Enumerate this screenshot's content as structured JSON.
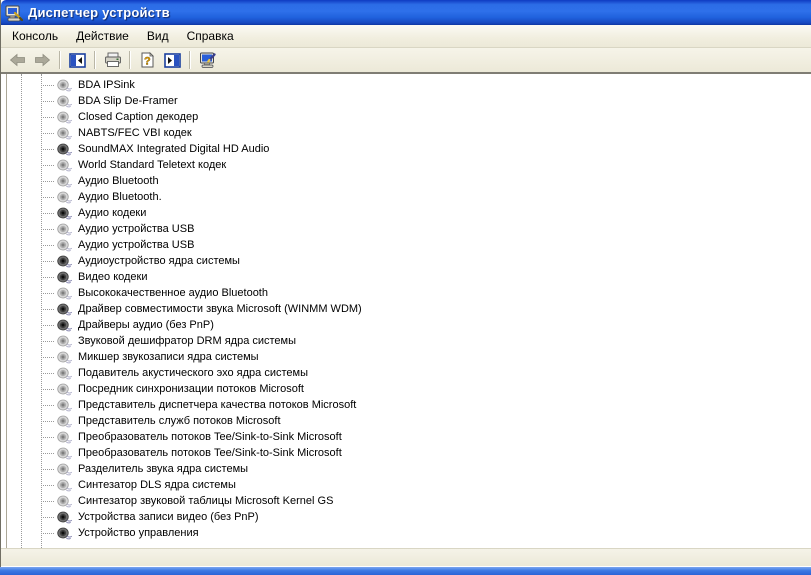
{
  "window": {
    "title": "Диспетчер устройств",
    "title_icon": "device-manager-computer-icon",
    "titlebar_color": "#2c6ce6"
  },
  "menu": {
    "items": [
      {
        "label": "Консоль"
      },
      {
        "label": "Действие"
      },
      {
        "label": "Вид"
      },
      {
        "label": "Справка"
      }
    ]
  },
  "toolbar": {
    "buttons": [
      {
        "name": "back-button",
        "icon": "arrow-left-icon",
        "enabled": false
      },
      {
        "name": "forward-button",
        "icon": "arrow-right-icon",
        "enabled": false
      },
      {
        "name": "show-console-tree-button",
        "icon": "panel-left-arrow-icon",
        "enabled": true
      },
      {
        "name": "print-button",
        "icon": "printer-icon",
        "enabled": true
      },
      {
        "name": "properties-button",
        "icon": "document-question-icon",
        "enabled": true
      },
      {
        "name": "show-action-pane-button",
        "icon": "panel-right-arrow-icon",
        "enabled": true
      },
      {
        "name": "scan-hardware-button",
        "icon": "computer-pen-icon",
        "enabled": true
      }
    ]
  },
  "tree": {
    "icon_meaning": {
      "dark": "active-device-speaker-icon",
      "light": "hidden-device-speaker-icon"
    },
    "items": [
      {
        "label": "BDA IPSink",
        "icon_variant": "light"
      },
      {
        "label": "BDA Slip De-Framer",
        "icon_variant": "light"
      },
      {
        "label": "Closed Caption декодер",
        "icon_variant": "light"
      },
      {
        "label": "NABTS/FEC VBI кодек",
        "icon_variant": "light"
      },
      {
        "label": "SoundMAX Integrated Digital HD Audio",
        "icon_variant": "dark"
      },
      {
        "label": "World Standard Teletext кодек",
        "icon_variant": "light"
      },
      {
        "label": "Аудио Bluetooth",
        "icon_variant": "light"
      },
      {
        "label": "Аудио Bluetooth.",
        "icon_variant": "light"
      },
      {
        "label": "Аудио кодеки",
        "icon_variant": "dark"
      },
      {
        "label": "Аудио устройства USB",
        "icon_variant": "light"
      },
      {
        "label": "Аудио устройства USB",
        "icon_variant": "light"
      },
      {
        "label": "Аудиоустройство ядра системы",
        "icon_variant": "dark"
      },
      {
        "label": "Видео кодеки",
        "icon_variant": "dark"
      },
      {
        "label": "Высококачественное аудио Bluetooth",
        "icon_variant": "light"
      },
      {
        "label": "Драйвер совместимости звука Microsoft (WINMM WDM)",
        "icon_variant": "dark"
      },
      {
        "label": "Драйверы аудио (без PnP)",
        "icon_variant": "dark"
      },
      {
        "label": "Звуковой дешифратор DRM ядра системы",
        "icon_variant": "light"
      },
      {
        "label": "Микшер звукозаписи ядра системы",
        "icon_variant": "light"
      },
      {
        "label": "Подавитель акустического эхо ядра системы",
        "icon_variant": "light"
      },
      {
        "label": "Посредник синхронизации потоков Microsoft",
        "icon_variant": "light"
      },
      {
        "label": "Представитель диспетчера качества потоков Microsoft",
        "icon_variant": "light"
      },
      {
        "label": "Представитель служб потоков Microsoft",
        "icon_variant": "light"
      },
      {
        "label": "Преобразователь потоков Tee/Sink-to-Sink Microsoft",
        "icon_variant": "light"
      },
      {
        "label": "Преобразователь потоков Tee/Sink-to-Sink Microsoft",
        "icon_variant": "light"
      },
      {
        "label": "Разделитель звука ядра системы",
        "icon_variant": "light"
      },
      {
        "label": "Синтезатор DLS ядра системы",
        "icon_variant": "light"
      },
      {
        "label": "Синтезатор звуковой таблицы Microsoft Kernel GS",
        "icon_variant": "light"
      },
      {
        "label": "Устройства записи видео (без PnP)",
        "icon_variant": "dark"
      },
      {
        "label": "Устройство управления",
        "icon_variant": "dark"
      }
    ]
  },
  "statusbar": {
    "text": ""
  },
  "colors": {
    "chrome_beige": "#ece9d8",
    "titlebar_blue": "#2c6ce6",
    "taskbar_blue": "#3b79e4",
    "tree_guides": "#9a9a9a"
  }
}
